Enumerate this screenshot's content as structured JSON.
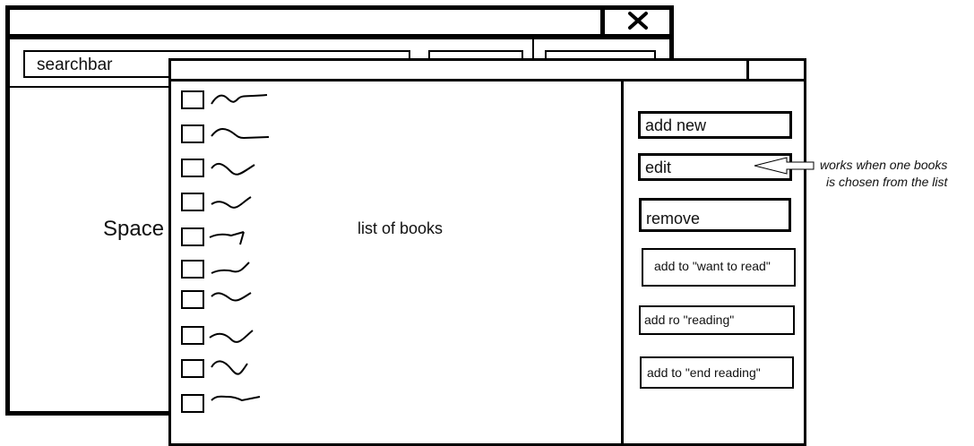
{
  "back_window": {
    "search_bar_text": "searchbar",
    "main_label": "Space"
  },
  "front_window": {
    "list_label": "list of books",
    "book_rows": 10,
    "actions": {
      "add_new": "add new",
      "edit": "edit",
      "remove": "remove",
      "want_to_read": "add to \"want to read\"",
      "reading": "add ro \"reading\"",
      "end_reading": "add to \"end reading\""
    }
  },
  "annotation": {
    "line1": "works when one books",
    "line2": "is chosen from the list"
  },
  "icons": {
    "close": "close-icon",
    "checkbox": "checkbox",
    "placeholder_title": "squiggle-placeholder"
  }
}
